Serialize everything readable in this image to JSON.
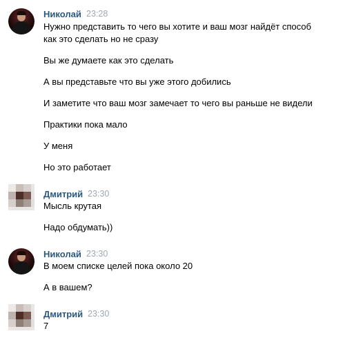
{
  "messages": [
    {
      "author": "Николай",
      "time": "23:28",
      "avatar": "avatar-nikolay",
      "lines": [
        "Нужно представить то чего вы хотите и ваш мозг найдёт способ",
        "как это сделать но не сразу",
        "Вы же думаете как это сделать",
        "А вы представьте что вы уже этого добились",
        "И заметите что ваш мозг замечает то чего вы раньше не видели",
        "Практики пока мало",
        "У меня",
        "Но это работает"
      ]
    },
    {
      "author": "Дмитрий",
      "time": "23:30",
      "avatar": "avatar-dmitriy-pixelated",
      "lines": [
        "Мысль крутая",
        "Надо обдумать))"
      ]
    },
    {
      "author": "Николай",
      "time": "23:30",
      "avatar": "avatar-nikolay",
      "lines": [
        "В моем списке целей пока около 20",
        "А в вашем?"
      ]
    },
    {
      "author": "Дмитрий",
      "time": "23:30",
      "avatar": "avatar-dmitriy-pixelated",
      "lines": [
        "7"
      ]
    }
  ],
  "colors": {
    "author": "#2a5885",
    "time": "#a0a7b1",
    "text": "#000000",
    "background": "#ffffff"
  }
}
